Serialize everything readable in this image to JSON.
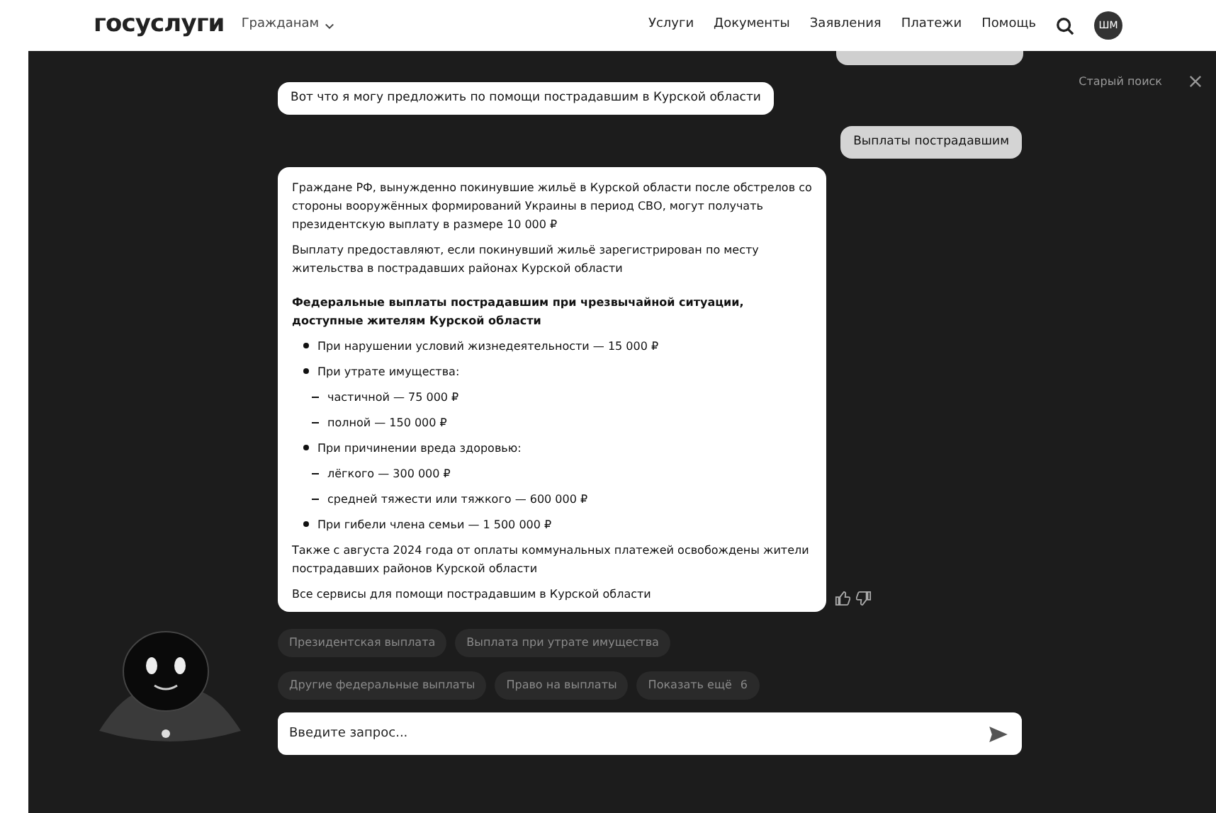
{
  "header": {
    "logo": "госуслуги",
    "audience": "Гражданам",
    "nav": [
      "Услуги",
      "Документы",
      "Заявления",
      "Платежи",
      "Помощь"
    ],
    "avatar": "ШМ"
  },
  "chat": {
    "old_search": "Старый поиск",
    "messages": [
      {
        "kind": "bot",
        "text": "Вот что я могу предложить по помощи пострадавшим в Курской области"
      },
      {
        "kind": "user",
        "text": "Выплаты пострадавшим"
      }
    ],
    "answer": [
      {
        "kind": "paragraph",
        "text": "Граждане РФ, вынужденно покинувшие жильё в Курской области после обстрелов со стороны вооружённых формирований Украины в период СВО, могут получать президентскую выплату в размере 10 000 ₽"
      },
      {
        "kind": "paragraph",
        "text": "Выплату предоставляют, если покинувший жильё зарегистрирован по месту жительства в пострадавших районах Курской области"
      },
      {
        "kind": "heading",
        "text": "Федеральные выплаты пострадавшим при чрезвычайной ситуации, доступные жителям Курской области"
      },
      {
        "kind": "bullet",
        "text": "При нарушении условий жизнедеятельности — 15 000 ₽"
      },
      {
        "kind": "bullet",
        "text": "При утрате имущества:",
        "children": [
          "частичной — 75 000 ₽",
          "полной — 150 000 ₽"
        ]
      },
      {
        "kind": "bullet",
        "text": "При причинении вреда здоровью:",
        "children": [
          "лёгкого — 300 000 ₽",
          "средней тяжести или тяжкого — 600 000 ₽"
        ]
      },
      {
        "kind": "bullet",
        "text": "При гибели члена семьи — 1 500 000 ₽"
      },
      {
        "kind": "paragraph",
        "text": "Также с августа 2024 года от оплаты коммунальных платежей освобождены жители пострадавших районов Курской области"
      },
      {
        "kind": "paragraph",
        "text": "Все сервисы для помощи пострадавшим в Курской области"
      }
    ],
    "suggestions": [
      [
        "Президентская выплата",
        "Выплата при утрате имущества"
      ],
      [
        "Другие федеральные выплаты",
        "Право на выплаты"
      ]
    ],
    "show_more": {
      "label": "Показать ещё",
      "count": "6"
    },
    "input": {
      "placeholder": "Введите запрос..."
    }
  }
}
